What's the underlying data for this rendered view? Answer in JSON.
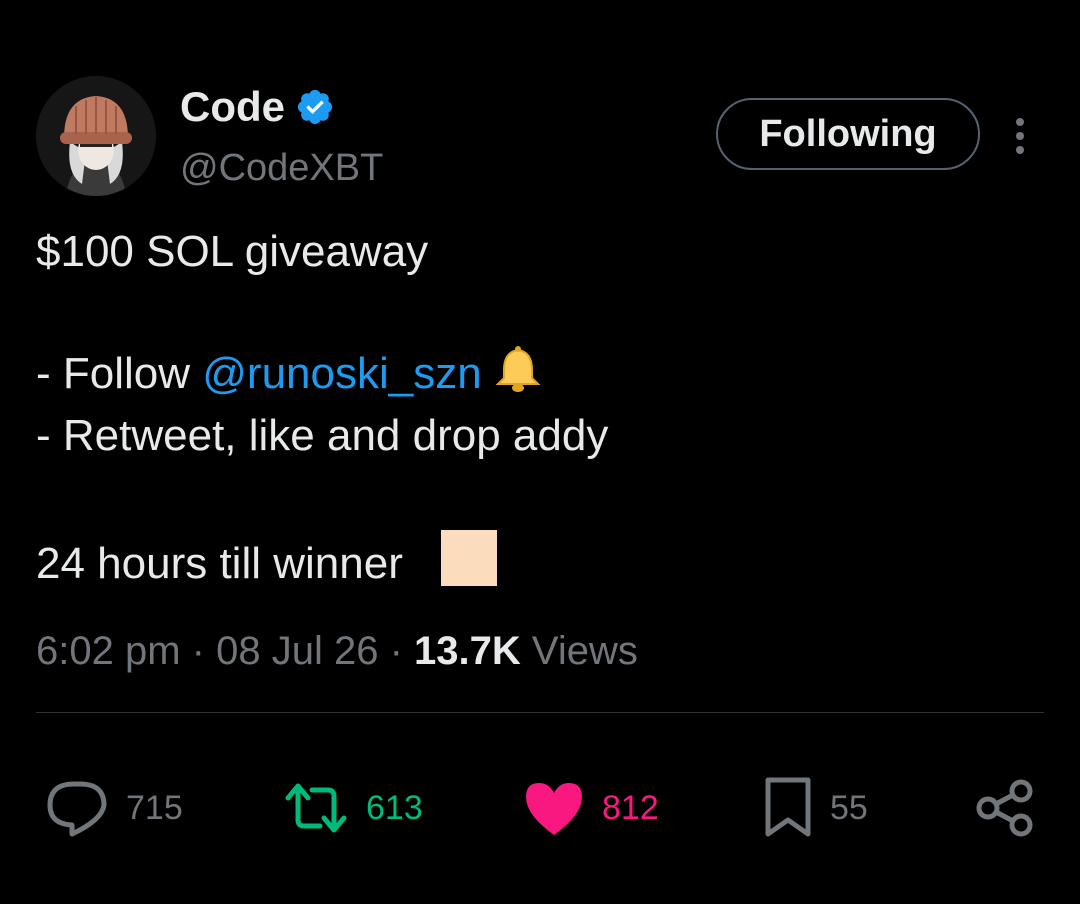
{
  "author": {
    "name": "Code",
    "handle": "@CodeXBT",
    "verified": true,
    "avatar_icon": "avatar-knit-hat"
  },
  "follow_button": {
    "label": "Following"
  },
  "more_menu": {
    "icon": "more-vertical-icon"
  },
  "tweet": {
    "line1": "$100 SOL giveaway",
    "line2_prefix": "- Follow ",
    "line2_mention": "@runoski_szn",
    "line2_emoji": "bell-icon",
    "line3": "- Retweet, like and drop addy",
    "line4": "24 hours till winner"
  },
  "meta": {
    "time": "6:02 pm",
    "separator": "·",
    "date": "08 Jul 26",
    "views_count": "13.7K",
    "views_label": "Views"
  },
  "actions": {
    "reply": {
      "count": "715",
      "icon": "reply-icon"
    },
    "retweet": {
      "count": "613",
      "icon": "retweet-icon"
    },
    "like": {
      "count": "812",
      "icon": "heart-icon"
    },
    "bookmark": {
      "count": "55",
      "icon": "bookmark-icon"
    },
    "share": {
      "icon": "share-icon"
    }
  },
  "colors": {
    "background": "#000000",
    "text": "#e7e9ea",
    "muted": "#71767b",
    "accent": "#1d9bf0",
    "retweet": "#00ba7c",
    "like": "#f91880"
  }
}
